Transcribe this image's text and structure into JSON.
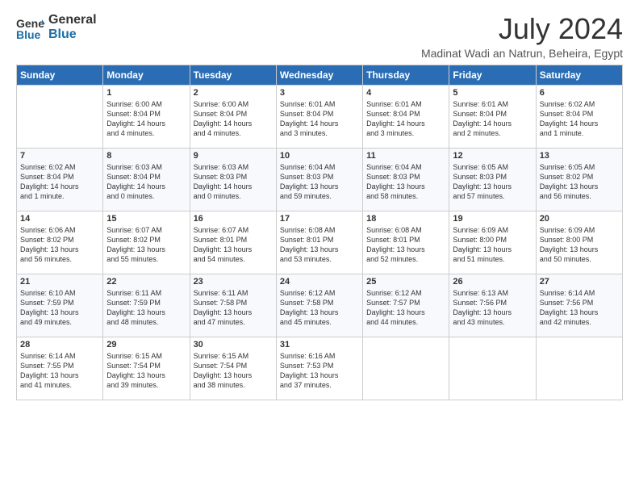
{
  "header": {
    "logo_general": "General",
    "logo_blue": "Blue",
    "month_year": "July 2024",
    "location": "Madinat Wadi an Natrun, Beheira, Egypt"
  },
  "days_of_week": [
    "Sunday",
    "Monday",
    "Tuesday",
    "Wednesday",
    "Thursday",
    "Friday",
    "Saturday"
  ],
  "weeks": [
    [
      {
        "day": "",
        "info": ""
      },
      {
        "day": "1",
        "info": "Sunrise: 6:00 AM\nSunset: 8:04 PM\nDaylight: 14 hours\nand 4 minutes."
      },
      {
        "day": "2",
        "info": "Sunrise: 6:00 AM\nSunset: 8:04 PM\nDaylight: 14 hours\nand 4 minutes."
      },
      {
        "day": "3",
        "info": "Sunrise: 6:01 AM\nSunset: 8:04 PM\nDaylight: 14 hours\nand 3 minutes."
      },
      {
        "day": "4",
        "info": "Sunrise: 6:01 AM\nSunset: 8:04 PM\nDaylight: 14 hours\nand 3 minutes."
      },
      {
        "day": "5",
        "info": "Sunrise: 6:01 AM\nSunset: 8:04 PM\nDaylight: 14 hours\nand 2 minutes."
      },
      {
        "day": "6",
        "info": "Sunrise: 6:02 AM\nSunset: 8:04 PM\nDaylight: 14 hours\nand 1 minute."
      }
    ],
    [
      {
        "day": "7",
        "info": "Sunrise: 6:02 AM\nSunset: 8:04 PM\nDaylight: 14 hours\nand 1 minute."
      },
      {
        "day": "8",
        "info": "Sunrise: 6:03 AM\nSunset: 8:04 PM\nDaylight: 14 hours\nand 0 minutes."
      },
      {
        "day": "9",
        "info": "Sunrise: 6:03 AM\nSunset: 8:03 PM\nDaylight: 14 hours\nand 0 minutes."
      },
      {
        "day": "10",
        "info": "Sunrise: 6:04 AM\nSunset: 8:03 PM\nDaylight: 13 hours\nand 59 minutes."
      },
      {
        "day": "11",
        "info": "Sunrise: 6:04 AM\nSunset: 8:03 PM\nDaylight: 13 hours\nand 58 minutes."
      },
      {
        "day": "12",
        "info": "Sunrise: 6:05 AM\nSunset: 8:03 PM\nDaylight: 13 hours\nand 57 minutes."
      },
      {
        "day": "13",
        "info": "Sunrise: 6:05 AM\nSunset: 8:02 PM\nDaylight: 13 hours\nand 56 minutes."
      }
    ],
    [
      {
        "day": "14",
        "info": "Sunrise: 6:06 AM\nSunset: 8:02 PM\nDaylight: 13 hours\nand 56 minutes."
      },
      {
        "day": "15",
        "info": "Sunrise: 6:07 AM\nSunset: 8:02 PM\nDaylight: 13 hours\nand 55 minutes."
      },
      {
        "day": "16",
        "info": "Sunrise: 6:07 AM\nSunset: 8:01 PM\nDaylight: 13 hours\nand 54 minutes."
      },
      {
        "day": "17",
        "info": "Sunrise: 6:08 AM\nSunset: 8:01 PM\nDaylight: 13 hours\nand 53 minutes."
      },
      {
        "day": "18",
        "info": "Sunrise: 6:08 AM\nSunset: 8:01 PM\nDaylight: 13 hours\nand 52 minutes."
      },
      {
        "day": "19",
        "info": "Sunrise: 6:09 AM\nSunset: 8:00 PM\nDaylight: 13 hours\nand 51 minutes."
      },
      {
        "day": "20",
        "info": "Sunrise: 6:09 AM\nSunset: 8:00 PM\nDaylight: 13 hours\nand 50 minutes."
      }
    ],
    [
      {
        "day": "21",
        "info": "Sunrise: 6:10 AM\nSunset: 7:59 PM\nDaylight: 13 hours\nand 49 minutes."
      },
      {
        "day": "22",
        "info": "Sunrise: 6:11 AM\nSunset: 7:59 PM\nDaylight: 13 hours\nand 48 minutes."
      },
      {
        "day": "23",
        "info": "Sunrise: 6:11 AM\nSunset: 7:58 PM\nDaylight: 13 hours\nand 47 minutes."
      },
      {
        "day": "24",
        "info": "Sunrise: 6:12 AM\nSunset: 7:58 PM\nDaylight: 13 hours\nand 45 minutes."
      },
      {
        "day": "25",
        "info": "Sunrise: 6:12 AM\nSunset: 7:57 PM\nDaylight: 13 hours\nand 44 minutes."
      },
      {
        "day": "26",
        "info": "Sunrise: 6:13 AM\nSunset: 7:56 PM\nDaylight: 13 hours\nand 43 minutes."
      },
      {
        "day": "27",
        "info": "Sunrise: 6:14 AM\nSunset: 7:56 PM\nDaylight: 13 hours\nand 42 minutes."
      }
    ],
    [
      {
        "day": "28",
        "info": "Sunrise: 6:14 AM\nSunset: 7:55 PM\nDaylight: 13 hours\nand 41 minutes."
      },
      {
        "day": "29",
        "info": "Sunrise: 6:15 AM\nSunset: 7:54 PM\nDaylight: 13 hours\nand 39 minutes."
      },
      {
        "day": "30",
        "info": "Sunrise: 6:15 AM\nSunset: 7:54 PM\nDaylight: 13 hours\nand 38 minutes."
      },
      {
        "day": "31",
        "info": "Sunrise: 6:16 AM\nSunset: 7:53 PM\nDaylight: 13 hours\nand 37 minutes."
      },
      {
        "day": "",
        "info": ""
      },
      {
        "day": "",
        "info": ""
      },
      {
        "day": "",
        "info": ""
      }
    ]
  ]
}
